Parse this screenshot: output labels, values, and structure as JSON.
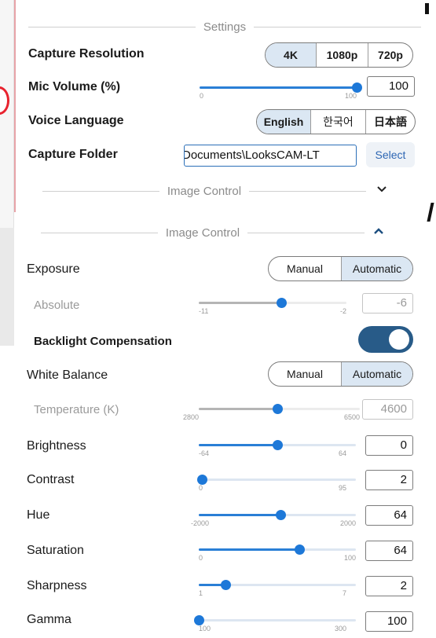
{
  "settings_header": "Settings",
  "settings": {
    "capture_resolution": {
      "label": "Capture Resolution",
      "options": [
        "4K",
        "1080p",
        "720p"
      ],
      "selected": "4K"
    },
    "mic_volume": {
      "label": "Mic Volume (%)",
      "min": "0",
      "max": "100",
      "value": "100",
      "level": 1.0
    },
    "voice_language": {
      "label": "Voice Language",
      "options": [
        "English",
        "한국어",
        "日本語"
      ],
      "selected": "English"
    },
    "capture_folder": {
      "label": "Capture Folder",
      "value": "Documents\\LooksCAM-LT",
      "button": "Select"
    }
  },
  "image_control_collapsed": {
    "title": "Image Control",
    "chevron": "chevron-down-icon"
  },
  "image_control": {
    "title": "Image Control",
    "chevron": "chevron-up-icon",
    "exposure": {
      "label": "Exposure",
      "options": [
        "Manual",
        "Automatic"
      ],
      "selected": "Automatic"
    },
    "absolute": {
      "label": "Absolute",
      "min": "-11",
      "max": "-2",
      "value": "-6",
      "level": 0.56
    },
    "backlight": {
      "label": "Backlight Compensation",
      "on": true
    },
    "white_balance": {
      "label": "White Balance",
      "options": [
        "Manual",
        "Automatic"
      ],
      "selected": "Automatic"
    },
    "temperature": {
      "label": "Temperature (K)",
      "min": "2800",
      "max": "6500",
      "value": "4600",
      "level": 0.49
    },
    "brightness": {
      "label": "Brightness",
      "min": "-64",
      "max": "64",
      "value": "0",
      "level": 0.5
    },
    "contrast": {
      "label": "Contrast",
      "min": "0",
      "max": "95",
      "value": "2",
      "level": 0.02
    },
    "hue": {
      "label": "Hue",
      "min": "-2000",
      "max": "2000",
      "value": "64",
      "level": 0.52
    },
    "saturation": {
      "label": "Saturation",
      "min": "0",
      "max": "100",
      "value": "64",
      "level": 0.64
    },
    "sharpness": {
      "label": "Sharpness",
      "min": "1",
      "max": "7",
      "value": "2",
      "level": 0.17
    },
    "gamma": {
      "label": "Gamma",
      "min": "100",
      "max": "300",
      "value": "100",
      "level": 0.0
    }
  },
  "colors": {
    "accent": "#1d78d8",
    "toggle_on": "#285b88",
    "selected_segment": "#dbe7f3"
  }
}
